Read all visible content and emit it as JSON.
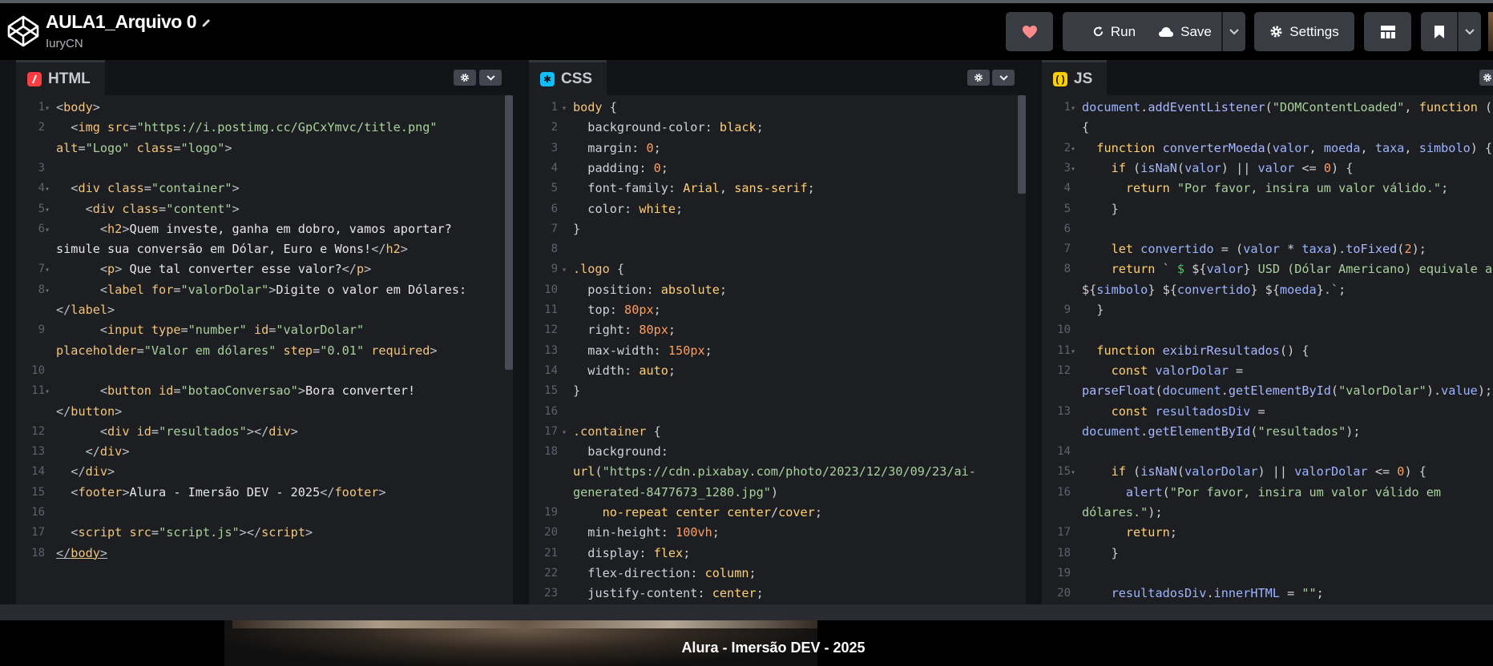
{
  "header": {
    "title": "AULA1_Arquivo 0",
    "user": "IuryCN",
    "buttons": {
      "run": "Run",
      "save": "Save",
      "settings": "Settings"
    }
  },
  "panes": {
    "html": {
      "label": "HTML",
      "lines": [
        {
          "num": "1",
          "fold": true,
          "html": "<span class='t'>&lt;</span><span class='tg'>body</span><span class='t'>&gt;</span>"
        },
        {
          "num": "2",
          "html": "  <span class='t'>&lt;</span><span class='tg'>img</span> <span class='at'>src</span><span class='p'>=</span><span class='s'>\"https://i.postimg.cc/GpCxYmvc/title.png\"</span>"
        },
        {
          "num": "",
          "html": "<span class='at'>alt</span><span class='p'>=</span><span class='s'>\"Logo\"</span> <span class='at'>class</span><span class='p'>=</span><span class='s'>\"logo\"</span><span class='t'>&gt;</span>"
        },
        {
          "num": "3",
          "html": ""
        },
        {
          "num": "4",
          "fold": true,
          "html": "  <span class='t'>&lt;</span><span class='tg'>div</span> <span class='at'>class</span><span class='p'>=</span><span class='s'>\"container\"</span><span class='t'>&gt;</span>"
        },
        {
          "num": "5",
          "fold": true,
          "html": "    <span class='t'>&lt;</span><span class='tg'>div</span> <span class='at'>class</span><span class='p'>=</span><span class='s'>\"content\"</span><span class='t'>&gt;</span>"
        },
        {
          "num": "6",
          "fold": true,
          "html": "      <span class='t'>&lt;</span><span class='tg'>h2</span><span class='t'>&gt;</span>Quem investe, ganha em dobro, vamos aportar?"
        },
        {
          "num": "",
          "html": "simule sua conversão em Dólar, Euro e Wons!<span class='t'>&lt;/</span><span class='tg'>h2</span><span class='t'>&gt;</span>"
        },
        {
          "num": "7",
          "fold": true,
          "html": "      <span class='t'>&lt;</span><span class='tg'>p</span><span class='t'>&gt;</span> Que tal converter esse valor?<span class='t'>&lt;/</span><span class='tg'>p</span><span class='t'>&gt;</span>"
        },
        {
          "num": "8",
          "fold": true,
          "html": "      <span class='t'>&lt;</span><span class='tg'>label</span> <span class='at'>for</span><span class='p'>=</span><span class='s'>\"valorDolar\"</span><span class='t'>&gt;</span>Digite o valor em Dólares:"
        },
        {
          "num": "",
          "html": "<span class='t'>&lt;/</span><span class='tg'>label</span><span class='t'>&gt;</span>"
        },
        {
          "num": "9",
          "html": "      <span class='t'>&lt;</span><span class='tg'>input</span> <span class='at'>type</span><span class='p'>=</span><span class='s'>\"number\"</span> <span class='at'>id</span><span class='p'>=</span><span class='s'>\"valorDolar\"</span>"
        },
        {
          "num": "",
          "html": "<span class='at'>placeholder</span><span class='p'>=</span><span class='s'>\"Valor em dólares\"</span> <span class='at'>step</span><span class='p'>=</span><span class='s'>\"0.01\"</span> <span class='at'>required</span><span class='t'>&gt;</span>"
        },
        {
          "num": "10",
          "html": ""
        },
        {
          "num": "11",
          "fold": true,
          "html": "      <span class='t'>&lt;</span><span class='tg'>button</span> <span class='at'>id</span><span class='p'>=</span><span class='s'>\"botaoConversao\"</span><span class='t'>&gt;</span>Bora converter!"
        },
        {
          "num": "",
          "html": "<span class='t'>&lt;/</span><span class='tg'>button</span><span class='t'>&gt;</span>"
        },
        {
          "num": "12",
          "html": "      <span class='t'>&lt;</span><span class='tg'>div</span> <span class='at'>id</span><span class='p'>=</span><span class='s'>\"resultados\"</span><span class='t'>&gt;&lt;/</span><span class='tg'>div</span><span class='t'>&gt;</span>"
        },
        {
          "num": "13",
          "html": "    <span class='t'>&lt;/</span><span class='tg'>div</span><span class='t'>&gt;</span>"
        },
        {
          "num": "14",
          "html": "  <span class='t'>&lt;/</span><span class='tg'>div</span><span class='t'>&gt;</span>"
        },
        {
          "num": "15",
          "html": "  <span class='t'>&lt;</span><span class='tg'>footer</span><span class='t'>&gt;</span>Alura - Imersão DEV - 2025<span class='t'>&lt;/</span><span class='tg'>footer</span><span class='t'>&gt;</span>"
        },
        {
          "num": "16",
          "html": ""
        },
        {
          "num": "17",
          "html": "  <span class='t'>&lt;</span><span class='tg'>script</span> <span class='at'>src</span><span class='p'>=</span><span class='s'>\"script.js\"</span><span class='t'>&gt;&lt;/</span><span class='tg'>script</span><span class='t'>&gt;</span>"
        },
        {
          "num": "18",
          "html": "<span class='t' style='text-decoration:underline'>&lt;/</span><span class='tg' style='text-decoration:underline'>body</span><span class='t' style='text-decoration:underline'>&gt;</span>"
        }
      ]
    },
    "css": {
      "label": "CSS",
      "lines": [
        {
          "num": "1",
          "fold": true,
          "html": "<span class='sel'>body</span> <span class='p'>{</span>"
        },
        {
          "num": "2",
          "html": "  <span class='prop'>background-color</span><span class='p'>:</span> <span class='val'>black</span><span class='p'>;</span>"
        },
        {
          "num": "3",
          "html": "  <span class='prop'>margin</span><span class='p'>:</span> <span class='num'>0</span><span class='p'>;</span>"
        },
        {
          "num": "4",
          "html": "  <span class='prop'>padding</span><span class='p'>:</span> <span class='num'>0</span><span class='p'>;</span>"
        },
        {
          "num": "5",
          "html": "  <span class='prop'>font-family</span><span class='p'>:</span> <span class='val'>Arial</span><span class='p'>,</span> <span class='val'>sans-serif</span><span class='p'>;</span>"
        },
        {
          "num": "6",
          "html": "  <span class='prop'>color</span><span class='p'>:</span> <span class='val'>white</span><span class='p'>;</span>"
        },
        {
          "num": "7",
          "html": "<span class='p'>}</span>"
        },
        {
          "num": "8",
          "html": ""
        },
        {
          "num": "9",
          "fold": true,
          "html": "<span class='sel'>.logo</span> <span class='p'>{</span>"
        },
        {
          "num": "10",
          "html": "  <span class='prop'>position</span><span class='p'>:</span> <span class='val'>absolute</span><span class='p'>;</span>"
        },
        {
          "num": "11",
          "html": "  <span class='prop'>top</span><span class='p'>:</span> <span class='num'>80px</span><span class='p'>;</span>"
        },
        {
          "num": "12",
          "html": "  <span class='prop'>right</span><span class='p'>:</span> <span class='num'>80px</span><span class='p'>;</span>"
        },
        {
          "num": "13",
          "html": "  <span class='prop'>max-width</span><span class='p'>:</span> <span class='num'>150px</span><span class='p'>;</span>"
        },
        {
          "num": "14",
          "html": "  <span class='prop'>width</span><span class='p'>:</span> <span class='val'>auto</span><span class='p'>;</span>"
        },
        {
          "num": "15",
          "html": "<span class='p'>}</span>"
        },
        {
          "num": "16",
          "html": ""
        },
        {
          "num": "17",
          "fold": true,
          "html": "<span class='sel'>.container</span> <span class='p'>{</span>"
        },
        {
          "num": "18",
          "html": "  <span class='prop'>background</span><span class='p'>:</span>"
        },
        {
          "num": "",
          "html": "<span class='val'>url</span><span class='p'>(</span><span class='str'>\"https://cdn.pixabay.com/photo/2023/12/30/09/23/ai-</span>"
        },
        {
          "num": "",
          "html": "<span class='str'>generated-8477673_1280.jpg\"</span><span class='p'>)</span>"
        },
        {
          "num": "19",
          "html": "    <span class='val'>no-repeat</span> <span class='val'>center</span> <span class='val'>center</span><span class='p'>/</span><span class='val'>cover</span><span class='p'>;</span>"
        },
        {
          "num": "20",
          "html": "  <span class='prop'>min-height</span><span class='p'>:</span> <span class='num'>100vh</span><span class='p'>;</span>"
        },
        {
          "num": "21",
          "html": "  <span class='prop'>display</span><span class='p'>:</span> <span class='val'>flex</span><span class='p'>;</span>"
        },
        {
          "num": "22",
          "html": "  <span class='prop'>flex-direction</span><span class='p'>:</span> <span class='val'>column</span><span class='p'>;</span>"
        },
        {
          "num": "23",
          "html": "  <span class='prop'>justify-content</span><span class='p'>:</span> <span class='val'>center</span><span class='p'>;</span>"
        }
      ]
    },
    "js": {
      "label": "JS",
      "lines": [
        {
          "num": "1",
          "fold": true,
          "html": "<span class='vr'>document</span><span class='p'>.</span><span class='fn'>addEventListener</span><span class='p'>(</span><span class='str'>\"DOMContentLoaded\"</span><span class='p'>,</span> <span class='kw'>function</span> <span class='p'>()</span>"
        },
        {
          "num": "",
          "html": "<span class='p'>{</span>"
        },
        {
          "num": "2",
          "fold": true,
          "html": "  <span class='kw'>function</span> <span class='fn'>converterMoeda</span><span class='p'>(</span><span class='vr'>valor</span><span class='p'>,</span> <span class='vr'>moeda</span><span class='p'>,</span> <span class='vr'>taxa</span><span class='p'>,</span> <span class='vr'>simbolo</span><span class='p'>) {</span>"
        },
        {
          "num": "3",
          "fold": true,
          "html": "    <span class='kw'>if</span> <span class='p'>(</span><span class='fn'>isNaN</span><span class='p'>(</span><span class='vr'>valor</span><span class='p'>) ||</span> <span class='vr'>valor</span> <span class='p'>&lt;=</span> <span class='num'>0</span><span class='p'>) {</span>"
        },
        {
          "num": "4",
          "html": "      <span class='kw'>return</span> <span class='str'>\"Por favor, insira um valor válido.\"</span><span class='p'>;</span>"
        },
        {
          "num": "5",
          "html": "    <span class='p'>}</span>"
        },
        {
          "num": "6",
          "html": ""
        },
        {
          "num": "7",
          "html": "    <span class='kw'>let</span> <span class='vr'>convertido</span> <span class='p'>= (</span><span class='vr'>valor</span> <span class='p'>*</span> <span class='vr'>taxa</span><span class='p'>).</span><span class='fn'>toFixed</span><span class='p'>(</span><span class='num'>2</span><span class='p'>);</span>"
        },
        {
          "num": "8",
          "html": "    <span class='kw'>return</span> <span class='str'>`</span> <span style='color:#39d353'>$</span> <span class='p'>${</span><span class='vr'>valor</span><span class='p'>}</span> <span class='str'>USD (Dólar Americano) equivale a</span>"
        },
        {
          "num": "",
          "html": "<span class='p'>${</span><span class='vr'>simbolo</span><span class='p'>}</span> <span class='p'>${</span><span class='vr'>convertido</span><span class='p'>}</span> <span class='p'>${</span><span class='vr'>moeda</span><span class='p'>}</span><span class='str'>.`</span><span class='p'>;</span>"
        },
        {
          "num": "9",
          "html": "  <span class='p'>}</span>"
        },
        {
          "num": "10",
          "html": ""
        },
        {
          "num": "11",
          "fold": true,
          "html": "  <span class='kw'>function</span> <span class='fn'>exibirResultados</span><span class='p'>() {</span>"
        },
        {
          "num": "12",
          "html": "    <span class='kw'>const</span> <span class='vr'>valorDolar</span> <span class='p'>=</span>"
        },
        {
          "num": "",
          "html": "<span class='fn'>parseFloat</span><span class='p'>(</span><span class='vr'>document</span><span class='p'>.</span><span class='fn'>getElementById</span><span class='p'>(</span><span class='str'>\"valorDolar\"</span><span class='p'>).</span><span class='vr'>value</span><span class='p'>);</span>"
        },
        {
          "num": "13",
          "html": "    <span class='kw'>const</span> <span class='vr'>resultadosDiv</span> <span class='p'>=</span>"
        },
        {
          "num": "",
          "html": "<span class='vr'>document</span><span class='p'>.</span><span class='fn'>getElementById</span><span class='p'>(</span><span class='str'>\"resultados\"</span><span class='p'>);</span>"
        },
        {
          "num": "14",
          "html": ""
        },
        {
          "num": "15",
          "fold": true,
          "html": "    <span class='kw'>if</span> <span class='p'>(</span><span class='fn'>isNaN</span><span class='p'>(</span><span class='vr'>valorDolar</span><span class='p'>) ||</span> <span class='vr'>valorDolar</span> <span class='p'>&lt;=</span> <span class='num'>0</span><span class='p'>) {</span>"
        },
        {
          "num": "16",
          "html": "      <span class='fn'>alert</span><span class='p'>(</span><span class='str'>\"Por favor, insira um valor válido em</span>"
        },
        {
          "num": "",
          "html": "<span class='str'>dólares.\"</span><span class='p'>);</span>"
        },
        {
          "num": "17",
          "html": "      <span class='kw'>return</span><span class='p'>;</span>"
        },
        {
          "num": "18",
          "html": "    <span class='p'>}</span>"
        },
        {
          "num": "19",
          "html": ""
        },
        {
          "num": "20",
          "html": "    <span class='vr'>resultadosDiv</span><span class='p'>.</span><span class='vr'>innerHTML</span> <span class='p'>=</span> <span class='str'>\"\"</span><span class='p'>;</span>"
        }
      ]
    }
  },
  "preview": {
    "footer_text": "Alura - Imersão DEV - 2025"
  },
  "colors": {
    "html_badge": "#ff3c41",
    "css_badge": "#0ebeff",
    "js_badge": "#fcd000",
    "button_bg": "#3a3c44"
  }
}
